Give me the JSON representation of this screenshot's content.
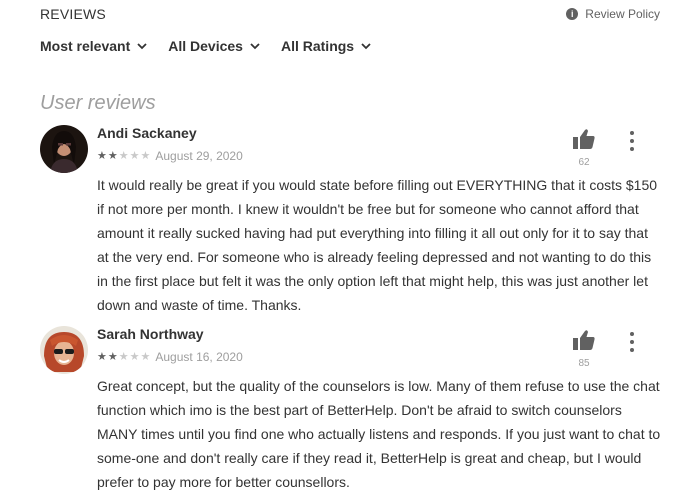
{
  "header": {
    "title": "REVIEWS",
    "policy_label": "Review Policy"
  },
  "filters": [
    {
      "label": "Most relevant"
    },
    {
      "label": "All Devices"
    },
    {
      "label": "All Ratings"
    }
  ],
  "section_title": "User reviews",
  "reviews": [
    {
      "author": "Andi Sackaney",
      "rating": 2,
      "max_rating": 5,
      "date": "August 29, 2020",
      "helpful_count": "62",
      "text": "It would really be great if you would state before filling out EVERYTHING that it costs $150 if not more per month. I knew it wouldn't be free but for someone who cannot afford that amount it really sucked having had put everything into filling it all out only for it to say that at the very end. For someone who is already feeling depressed and not wanting to do this in the first place but felt it was the only option left that might help, this was just another let down and waste of time. Thanks."
    },
    {
      "author": "Sarah Northway",
      "rating": 2,
      "max_rating": 5,
      "date": "August 16, 2020",
      "helpful_count": "85",
      "text": "Great concept, but the quality of the counselors is low. Many of them refuse to use the chat function which imo is the best part of BetterHelp. Don't be afraid to switch counselors MANY times until you find one who actually listens and responds. If you just want to chat to some-one and don't really care if they read it, BetterHelp is great and cheap, but I would prefer to pay more for better counsellors."
    }
  ],
  "colors": {
    "text": "#333333",
    "muted": "#9e9e9e",
    "icon": "#616161",
    "star_off": "#c9c9c9"
  },
  "icons": {
    "info": "info-icon",
    "chevron": "chevron-down-icon",
    "thumb": "thumbs-up-icon",
    "more": "more-vert-icon"
  }
}
